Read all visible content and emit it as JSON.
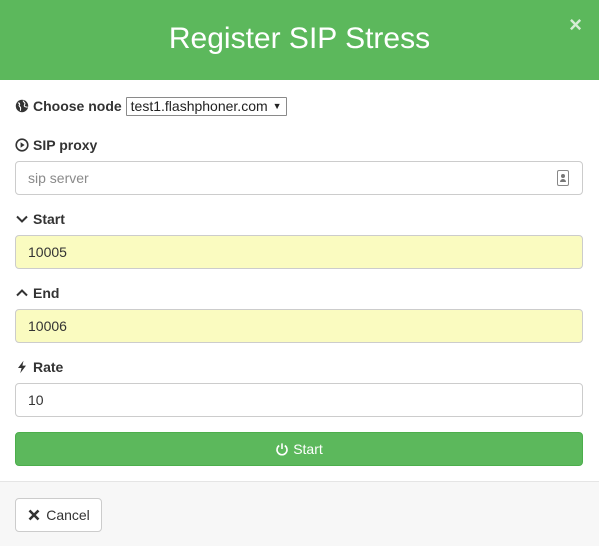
{
  "header": {
    "title": "Register SIP Stress",
    "close_glyph": "×"
  },
  "node": {
    "label": "Choose node",
    "selected": "test1.flashphoner.com"
  },
  "sip_proxy": {
    "label": "SIP proxy",
    "placeholder": "sip server",
    "value": ""
  },
  "start": {
    "label": "Start",
    "value": "10005"
  },
  "end": {
    "label": "End",
    "value": "10006"
  },
  "rate": {
    "label": "Rate",
    "value": "10"
  },
  "start_button": {
    "label": "Start"
  },
  "footer": {
    "cancel_label": "Cancel"
  },
  "colors": {
    "header_green": "#5cb85c",
    "field_highlight": "#fafbc0"
  },
  "icons": {
    "node": "globe-icon",
    "sip_proxy": "play-circle-icon",
    "start": "chevron-down-icon",
    "end": "chevron-up-icon",
    "rate": "lightning-icon",
    "start_button": "power-icon",
    "cancel": "close-icon",
    "proxy_field": "contact-card-icon"
  }
}
